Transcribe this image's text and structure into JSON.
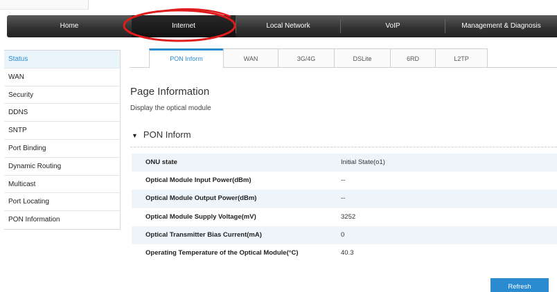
{
  "nav": {
    "items": [
      {
        "label": "Home"
      },
      {
        "label": "Internet"
      },
      {
        "label": "Local Network"
      },
      {
        "label": "VoIP"
      },
      {
        "label": "Management & Diagnosis"
      }
    ],
    "active_index": 1
  },
  "sidebar": {
    "items": [
      {
        "label": "Status"
      },
      {
        "label": "WAN"
      },
      {
        "label": "Security"
      },
      {
        "label": "DDNS"
      },
      {
        "label": "SNTP"
      },
      {
        "label": "Port Binding"
      },
      {
        "label": "Dynamic Routing"
      },
      {
        "label": "Multicast"
      },
      {
        "label": "Port Locating"
      },
      {
        "label": "PON Information"
      }
    ],
    "active_index": 0
  },
  "tabs": {
    "items": [
      {
        "label": "PON Inform"
      },
      {
        "label": "WAN"
      },
      {
        "label": "3G/4G"
      },
      {
        "label": "DSLite"
      },
      {
        "label": "6RD"
      },
      {
        "label": "L2TP"
      }
    ],
    "active_index": 0
  },
  "page": {
    "title": "Page Information",
    "description": "Display the optical module"
  },
  "section": {
    "title": "PON Inform",
    "rows": [
      {
        "label": "ONU state",
        "value": "Initial State(o1)"
      },
      {
        "label": "Optical Module Input Power(dBm)",
        "value": "--"
      },
      {
        "label": "Optical Module Output Power(dBm)",
        "value": "--"
      },
      {
        "label": "Optical Module Supply Voltage(mV)",
        "value": "3252"
      },
      {
        "label": "Optical Transmitter Bias Current(mA)",
        "value": "0"
      },
      {
        "label": "Operating Temperature of the Optical Module(°C)",
        "value": "40.3"
      }
    ]
  },
  "actions": {
    "refresh_label": "Refresh"
  },
  "colors": {
    "accent": "#2a8bd0",
    "annotation": "#e01b1b",
    "row_shade": "#eef5fa"
  },
  "icons": {
    "section_toggle": "triangle-down-icon"
  }
}
